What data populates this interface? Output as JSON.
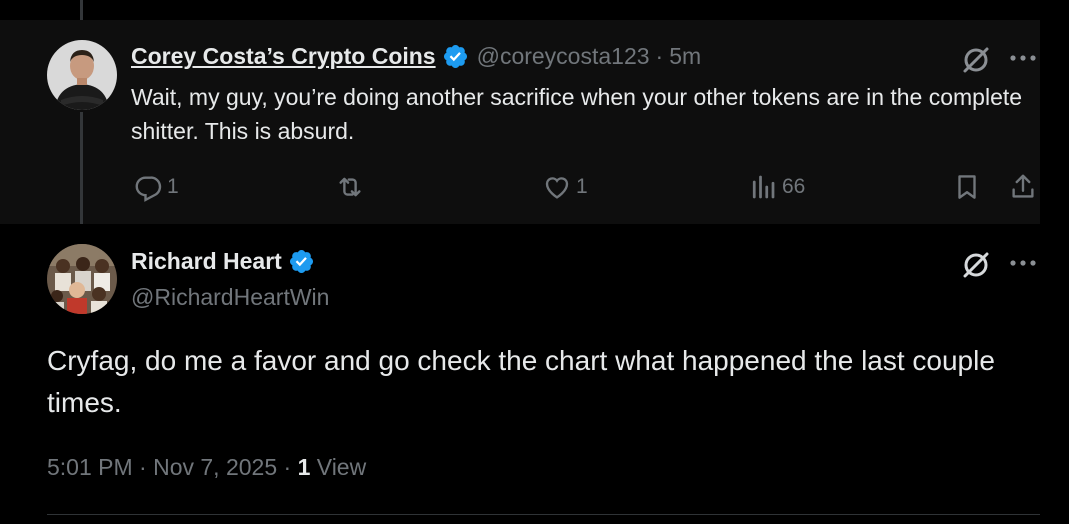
{
  "reply": {
    "display_name": "Corey Costa’s Crypto Coins",
    "handle": "@coreycosta123",
    "separator": "·",
    "time": "5m",
    "text": "Wait, my guy, you’re doing another sacrifice when your other tokens are in the complete shitter. This is absurd.",
    "replies_count": "1",
    "likes_count": "1",
    "views_count": "66"
  },
  "main": {
    "display_name": "Richard Heart",
    "handle": "@RichardHeartWin",
    "text": "Cryfag, do me a favor and go check the chart what happened the last couple times.",
    "timestamp": "5:01 PM · Nov 7, 2025 · ",
    "view_count": "1",
    "view_label": " View"
  },
  "colors": {
    "background": "#000000",
    "reply_background": "#0e0e0e",
    "text_primary": "#e7e9ea",
    "text_secondary": "#71767b",
    "verified_blue": "#1d9bf0"
  }
}
